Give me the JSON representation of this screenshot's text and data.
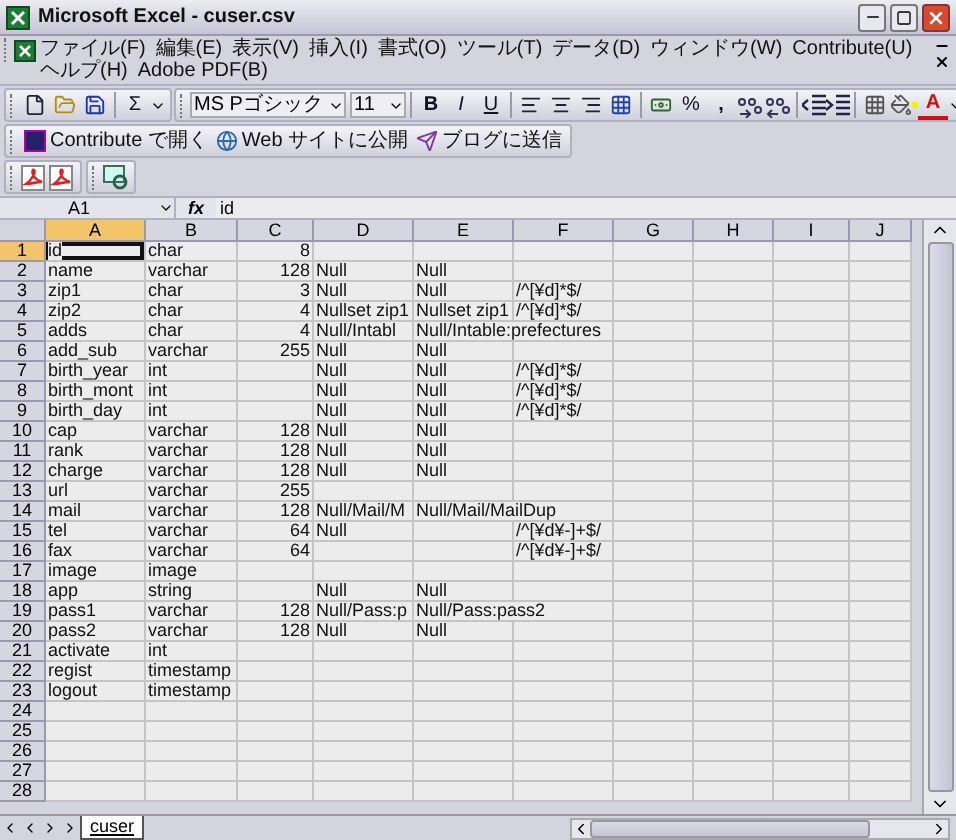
{
  "window": {
    "title": "Microsoft Excel - cuser.csv"
  },
  "menu": [
    "ファイル(F)",
    "編集(E)",
    "表示(V)",
    "挿入(I)",
    "書式(O)",
    "ツール(T)",
    "データ(D)",
    "ウィンドウ(W)",
    "Contribute(U)",
    "ヘルプ(H)",
    "Adobe PDF(B)"
  ],
  "toolbar": {
    "sum": "Σ",
    "font": "MS Pゴシック",
    "size": "11",
    "bold": "B",
    "italic": "I",
    "underline": "U",
    "percent": "%",
    "comma": ",",
    "font_color": "A"
  },
  "web_toolbar": [
    "Contribute で開く",
    "Web サイトに公開",
    "ブログに送信"
  ],
  "formula_bar": {
    "name_box": "A1",
    "fx": "fx",
    "value": "id"
  },
  "columns": [
    {
      "label": "A",
      "kind": "text",
      "selected": true
    },
    {
      "label": "B",
      "kind": "text",
      "selected": false
    },
    {
      "label": "C",
      "kind": "number",
      "selected": false
    },
    {
      "label": "D",
      "kind": "text",
      "selected": false
    },
    {
      "label": "E",
      "kind": "text",
      "selected": false
    },
    {
      "label": "F",
      "kind": "text",
      "selected": false
    },
    {
      "label": "G",
      "kind": "text",
      "selected": false
    },
    {
      "label": "H",
      "kind": "text",
      "selected": false
    },
    {
      "label": "I",
      "kind": "text",
      "selected": false
    },
    {
      "label": "J",
      "kind": "text",
      "selected": false
    }
  ],
  "rows": [
    {
      "label": "1",
      "selected": true,
      "cells": {
        "A": "id",
        "B": "char",
        "C": "8"
      }
    },
    {
      "label": "2",
      "selected": false,
      "cells": {
        "A": "name",
        "B": "varchar",
        "C": "128",
        "D": "Null",
        "E": "Null"
      }
    },
    {
      "label": "3",
      "selected": false,
      "cells": {
        "A": "zip1",
        "B": "char",
        "C": "3",
        "D": "Null",
        "E": "Null",
        "F": "/^[¥d]*$/"
      }
    },
    {
      "label": "4",
      "selected": false,
      "cells": {
        "A": "zip2",
        "B": "char",
        "C": "4",
        "D": "Nullset zip1",
        "E": "Nullset zip1",
        "F": "/^[¥d]*$/"
      }
    },
    {
      "label": "5",
      "selected": false,
      "cells": {
        "A": "adds",
        "B": "char",
        "C": "4",
        "D": "Null/Intabl",
        "E": {
          "text": "Null/Intable:prefectures",
          "overflow": true
        }
      }
    },
    {
      "label": "6",
      "selected": false,
      "cells": {
        "A": "add_sub",
        "B": "varchar",
        "C": "255",
        "D": "Null",
        "E": "Null"
      }
    },
    {
      "label": "7",
      "selected": false,
      "cells": {
        "A": "birth_year",
        "B": "int",
        "D": "Null",
        "E": "Null",
        "F": "/^[¥d]*$/"
      }
    },
    {
      "label": "8",
      "selected": false,
      "cells": {
        "A": "birth_mont",
        "B": "int",
        "D": "Null",
        "E": "Null",
        "F": "/^[¥d]*$/"
      }
    },
    {
      "label": "9",
      "selected": false,
      "cells": {
        "A": "birth_day",
        "B": "int",
        "D": "Null",
        "E": "Null",
        "F": "/^[¥d]*$/"
      }
    },
    {
      "label": "10",
      "selected": false,
      "cells": {
        "A": "cap",
        "B": "varchar",
        "C": "128",
        "D": "Null",
        "E": "Null"
      }
    },
    {
      "label": "11",
      "selected": false,
      "cells": {
        "A": "rank",
        "B": "varchar",
        "C": "128",
        "D": "Null",
        "E": "Null"
      }
    },
    {
      "label": "12",
      "selected": false,
      "cells": {
        "A": "charge",
        "B": "varchar",
        "C": "128",
        "D": "Null",
        "E": "Null"
      }
    },
    {
      "label": "13",
      "selected": false,
      "cells": {
        "A": "url",
        "B": "varchar",
        "C": "255"
      }
    },
    {
      "label": "14",
      "selected": false,
      "cells": {
        "A": "mail",
        "B": "varchar",
        "C": "128",
        "D": "Null/Mail/M",
        "E": {
          "text": "Null/Mail/MailDup",
          "overflow": true
        }
      }
    },
    {
      "label": "15",
      "selected": false,
      "cells": {
        "A": "tel",
        "B": "varchar",
        "C": "64",
        "D": "Null",
        "F": "/^[¥d¥-]+$/"
      }
    },
    {
      "label": "16",
      "selected": false,
      "cells": {
        "A": "fax",
        "B": "varchar",
        "C": "64",
        "F": "/^[¥d¥-]+$/"
      }
    },
    {
      "label": "17",
      "selected": false,
      "cells": {
        "A": "image",
        "B": "image"
      }
    },
    {
      "label": "18",
      "selected": false,
      "cells": {
        "A": "app",
        "B": "string",
        "D": "Null",
        "E": "Null"
      }
    },
    {
      "label": "19",
      "selected": false,
      "cells": {
        "A": "pass1",
        "B": "varchar",
        "C": "128",
        "D": "Null/Pass:p",
        "E": {
          "text": "Null/Pass:pass2",
          "overflow": true
        }
      }
    },
    {
      "label": "20",
      "selected": false,
      "cells": {
        "A": "pass2",
        "B": "varchar",
        "C": "128",
        "D": "Null",
        "E": "Null"
      }
    },
    {
      "label": "21",
      "selected": false,
      "cells": {
        "A": "activate",
        "B": "int"
      }
    },
    {
      "label": "22",
      "selected": false,
      "cells": {
        "A": "regist",
        "B": "timestamp"
      }
    },
    {
      "label": "23",
      "selected": false,
      "cells": {
        "A": "logout",
        "B": "timestamp"
      }
    },
    {
      "label": "24",
      "selected": false,
      "cells": {}
    },
    {
      "label": "25",
      "selected": false,
      "cells": {}
    },
    {
      "label": "26",
      "selected": false,
      "cells": {}
    },
    {
      "label": "27",
      "selected": false,
      "cells": {}
    },
    {
      "label": "28",
      "selected": false,
      "cells": {}
    }
  ],
  "sheet_tabs": [
    {
      "label": "cuser",
      "selected": true
    }
  ]
}
